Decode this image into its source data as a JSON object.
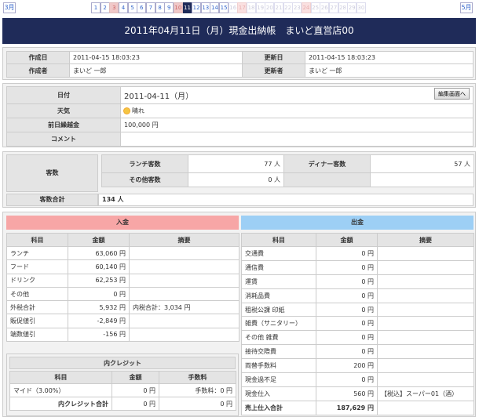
{
  "nav": {
    "prev_month": "3月",
    "next_month": "5月",
    "days": [
      {
        "d": "1",
        "s": ""
      },
      {
        "d": "2",
        "s": ""
      },
      {
        "d": "3",
        "s": "red"
      },
      {
        "d": "4",
        "s": ""
      },
      {
        "d": "5",
        "s": ""
      },
      {
        "d": "6",
        "s": ""
      },
      {
        "d": "7",
        "s": ""
      },
      {
        "d": "8",
        "s": ""
      },
      {
        "d": "9",
        "s": ""
      },
      {
        "d": "10",
        "s": "red"
      },
      {
        "d": "11",
        "s": "cur"
      },
      {
        "d": "12",
        "s": ""
      },
      {
        "d": "13",
        "s": ""
      },
      {
        "d": "14",
        "s": ""
      },
      {
        "d": "15",
        "s": ""
      },
      {
        "d": "16",
        "s": "dim"
      },
      {
        "d": "17",
        "s": "dimred"
      },
      {
        "d": "18",
        "s": "dim"
      },
      {
        "d": "19",
        "s": "dim"
      },
      {
        "d": "20",
        "s": "dim"
      },
      {
        "d": "21",
        "s": "dim"
      },
      {
        "d": "22",
        "s": "dim"
      },
      {
        "d": "23",
        "s": "dim"
      },
      {
        "d": "24",
        "s": "dimred"
      },
      {
        "d": "25",
        "s": "dim"
      },
      {
        "d": "26",
        "s": "dim"
      },
      {
        "d": "27",
        "s": "dim"
      },
      {
        "d": "28",
        "s": "dim"
      },
      {
        "d": "29",
        "s": "dim"
      },
      {
        "d": "30",
        "s": "dim"
      }
    ]
  },
  "title": "2011年04月11日（月）現金出納帳　まいど直営店00",
  "meta": {
    "created_label": "作成日",
    "created_value": "2011-04-15 18:03:23",
    "updated_label": "更新日",
    "updated_value": "2011-04-15 18:03:23",
    "author_label": "作成者",
    "author_value": "まいど 一郎",
    "updater_label": "更新者",
    "updater_value": "まいど 一郎"
  },
  "info": {
    "date_label": "日付",
    "date_value": "2011-04-11（月）",
    "edit_button": "編集画面へ",
    "weather_label": "天気",
    "weather_value": "晴れ",
    "carry_label": "前日繰越金",
    "carry_value": "100,000 円",
    "comment_label": "コメント",
    "comment_value": ""
  },
  "customers": {
    "label": "客数",
    "lunch_label": "ランチ客数",
    "lunch_value": "77 人",
    "dinner_label": "ディナー客数",
    "dinner_value": "57 人",
    "other_label": "その他客数",
    "other_value": "0 人",
    "total_label": "客数合計",
    "total_value": "134 人"
  },
  "income": {
    "header": "入金",
    "col_item": "科目",
    "col_amount": "金額",
    "col_note": "摘要",
    "rows": [
      {
        "item": "ランチ",
        "amount": "63,060 円",
        "note": ""
      },
      {
        "item": "フード",
        "amount": "60,140 円",
        "note": ""
      },
      {
        "item": "ドリンク",
        "amount": "62,253 円",
        "note": ""
      },
      {
        "item": "その他",
        "amount": "0 円",
        "note": ""
      },
      {
        "item": "外税合計",
        "amount": "5,932 円",
        "note": "内税合計：3,034 円"
      },
      {
        "item": "販促値引",
        "amount": "-2,849 円",
        "note": ""
      },
      {
        "item": "端数値引",
        "amount": "-156 円",
        "note": ""
      }
    ]
  },
  "credit": {
    "header": "内クレジット",
    "col_item": "科目",
    "col_amount": "金額",
    "col_fee": "手数料",
    "row_item": "マイド（3.00%）",
    "row_amount": "0 円",
    "row_fee": "手数料：0 円",
    "total_label": "内クレジット合計",
    "total_amount": "0 円",
    "total_fee": "0 円"
  },
  "expense": {
    "header": "出金",
    "col_item": "科目",
    "col_amount": "金額",
    "col_note": "摘要",
    "rows": [
      {
        "item": "交通費",
        "amount": "0 円",
        "note": ""
      },
      {
        "item": "通信費",
        "amount": "0 円",
        "note": ""
      },
      {
        "item": "運賃",
        "amount": "0 円",
        "note": ""
      },
      {
        "item": "消耗品費",
        "amount": "0 円",
        "note": ""
      },
      {
        "item": "租税公課 印紙",
        "amount": "0 円",
        "note": ""
      },
      {
        "item": "雑費（サニタリー）",
        "amount": "0 円",
        "note": ""
      },
      {
        "item": "その他 雑費",
        "amount": "0 円",
        "note": ""
      },
      {
        "item": "接待交際費",
        "amount": "0 円",
        "note": ""
      },
      {
        "item": "両替手数料",
        "amount": "200 円",
        "note": ""
      },
      {
        "item": "現金過不足",
        "amount": "0 円",
        "note": ""
      },
      {
        "item": "現金仕入",
        "amount": "560 円",
        "note": "【税込】スーパー01（酒）"
      },
      {
        "item": "売上仕入合計",
        "amount": "187,629 円",
        "note": ""
      }
    ]
  }
}
